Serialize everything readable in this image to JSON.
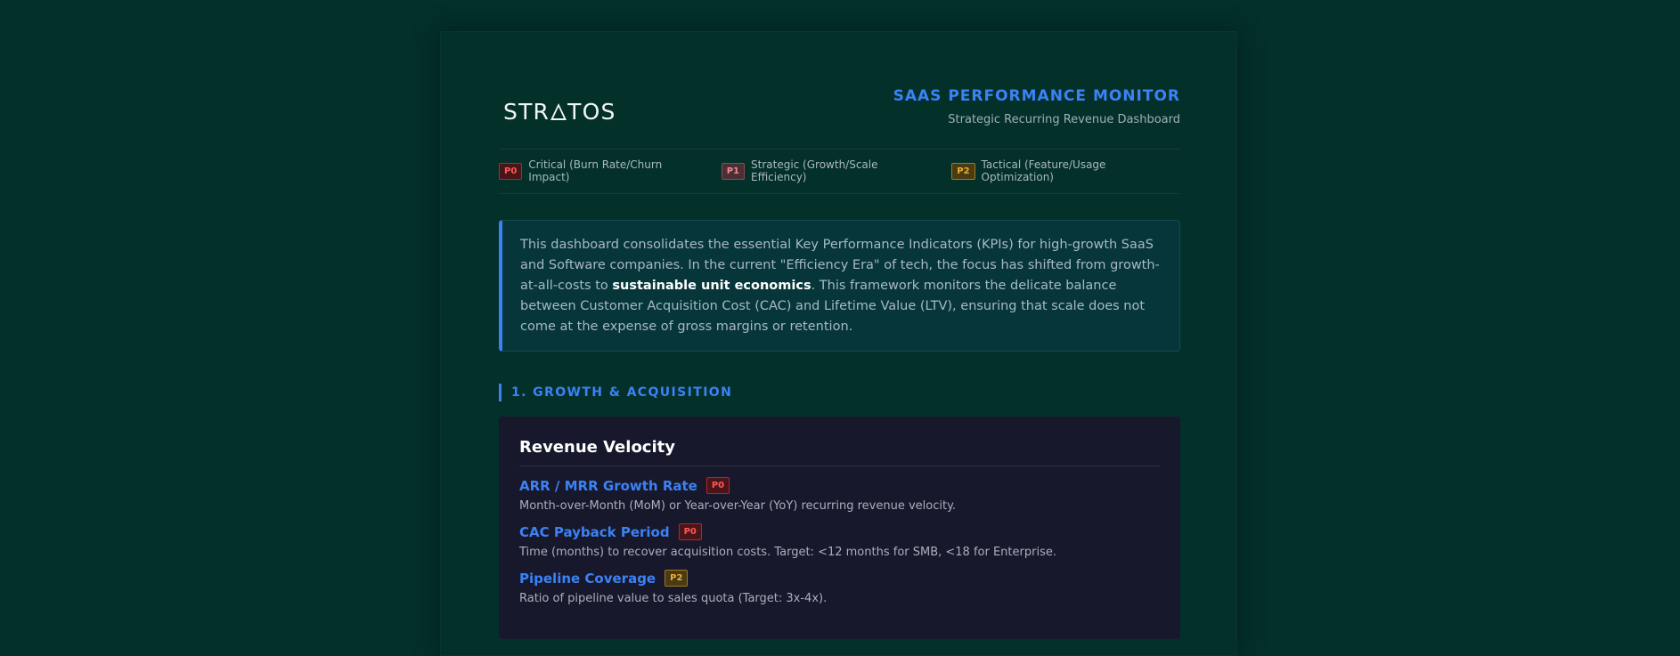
{
  "header": {
    "logo_left": "STR",
    "logo_right": "TOS",
    "title": "SAAS PERFORMANCE MONITOR",
    "subtitle": "Strategic Recurring Revenue Dashboard"
  },
  "legend": [
    {
      "badge": "P0",
      "label": "Critical (Burn Rate/Churn Impact)"
    },
    {
      "badge": "P1",
      "label": "Strategic (Growth/Scale Efficiency)"
    },
    {
      "badge": "P2",
      "label": "Tactical (Feature/Usage Optimization)"
    }
  ],
  "intro": {
    "text_before": "This dashboard consolidates the essential Key Performance Indicators (KPIs) for high-growth SaaS and Software companies. In the current \"Efficiency Era\" of tech, the focus has shifted from growth-at-all-costs to ",
    "emphasis": "sustainable unit economics",
    "text_after": ". This framework monitors the delicate balance between Customer Acquisition Cost (CAC) and Lifetime Value (LTV), ensuring that scale does not come at the expense of gross margins or retention."
  },
  "section": {
    "title": "1. GROWTH & ACQUISITION",
    "card": {
      "title": "Revenue Velocity",
      "metrics": [
        {
          "name": "ARR / MRR Growth Rate",
          "badge": "P0",
          "desc": "Month-over-Month (MoM) or Year-over-Year (YoY) recurring revenue velocity."
        },
        {
          "name": "CAC Payback Period",
          "badge": "P0",
          "desc": "Time (months) to recover acquisition costs. Target: <12 months for SMB, <18 for Enterprise."
        },
        {
          "name": "Pipeline Coverage",
          "badge": "P2",
          "desc": "Ratio of pipeline value to sales quota (Target: 3x-4x)."
        }
      ]
    }
  },
  "colors": {
    "background": "#03302a",
    "accent": "#3b82f6",
    "p0": "#ff5a55",
    "p1": "#f08b8e",
    "p2": "#e6b030"
  }
}
